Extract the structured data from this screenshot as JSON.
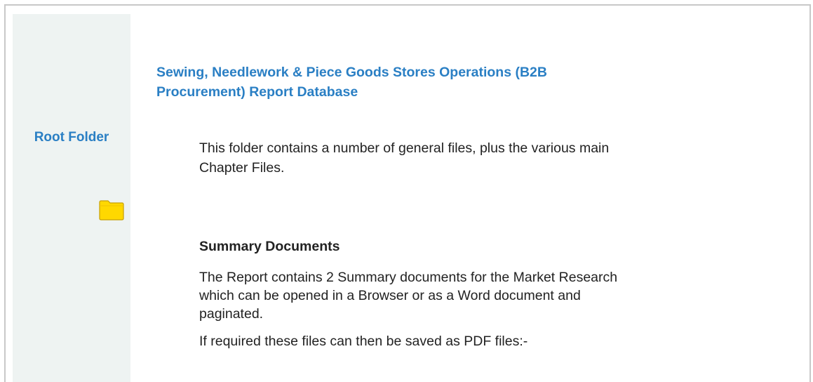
{
  "sidebar": {
    "root_folder_label": "Root Folder",
    "folder_icon": "folder-icon"
  },
  "main": {
    "title": "Sewing, Needlework & Piece Goods Stores Operations (B2B Procurement) Report Database",
    "intro": "This folder contains a number of general files, plus the various main Chapter Files.",
    "summary_heading": "Summary Documents",
    "summary_desc": "The Report contains 2 Summary documents for the Market Research which can be opened in a Browser or as a Word document and paginated.",
    "pdf_note": "If required these files can then be saved as PDF files:-"
  },
  "colors": {
    "accent": "#2a7fc4",
    "side_panel_bg": "#eef3f2",
    "folder_fill": "#ffd800",
    "folder_border": "#c8a000"
  }
}
